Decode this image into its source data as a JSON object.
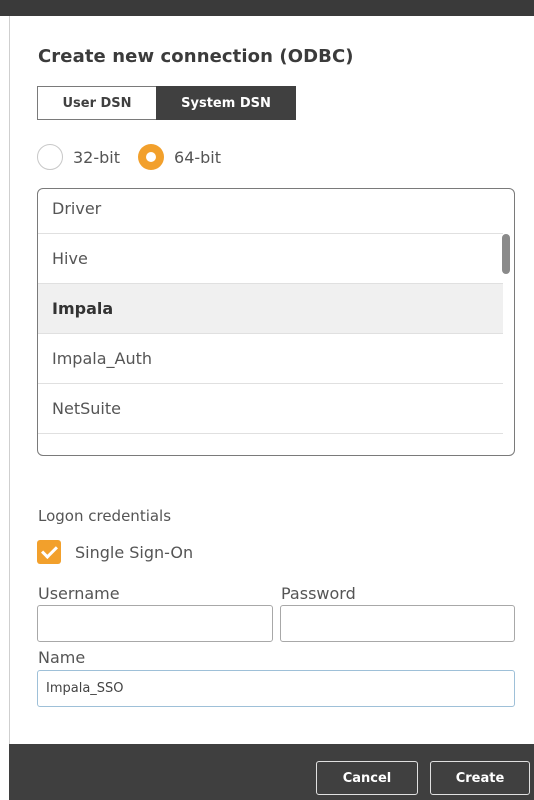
{
  "dialog": {
    "title": "Create new connection (ODBC)"
  },
  "dsn_tabs": [
    {
      "label": "User DSN",
      "selected": false
    },
    {
      "label": "System DSN",
      "selected": true
    }
  ],
  "bitness": {
    "options": [
      "32-bit",
      "64-bit"
    ],
    "selected": "64-bit"
  },
  "driver_list": {
    "items": [
      "Driver",
      "Hive",
      "Impala",
      "Impala_Auth",
      "NetSuite"
    ],
    "selected": "Impala"
  },
  "credentials": {
    "section_label": "Logon credentials",
    "sso_label": "Single Sign-On",
    "sso_checked": true,
    "username_label": "Username",
    "username_value": "",
    "password_label": "Password",
    "password_value": ""
  },
  "name_field": {
    "label": "Name",
    "value": "Impala_SSO"
  },
  "footer": {
    "cancel_label": "Cancel",
    "create_label": "Create"
  },
  "colors": {
    "accent": "#f2a02c",
    "dark": "#404040",
    "footer": "#3f3f3f"
  }
}
